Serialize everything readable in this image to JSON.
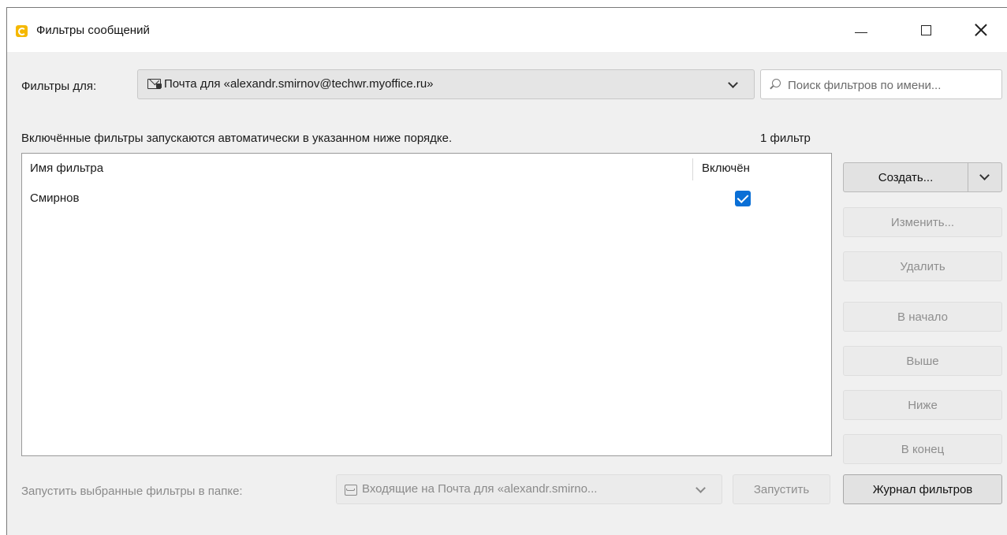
{
  "window": {
    "title": "Фильтры сообщений",
    "minimize_icon": "minimize-icon",
    "maximize_icon": "maximize-icon",
    "close_icon": "close-icon"
  },
  "filters_for": {
    "label": "Фильтры для:",
    "account_value": "Почта для «alexandr.smirnov@techwr.myoffice.ru»"
  },
  "search": {
    "placeholder": "Поиск фильтров по имени..."
  },
  "info": {
    "text": "Включённые фильтры запускаются автоматически в указанном ниже порядке.",
    "count": "1 фильтр"
  },
  "table": {
    "columns": [
      "Имя фильтра",
      "Включён"
    ],
    "rows": [
      {
        "name": "Смирнов",
        "enabled": true
      }
    ]
  },
  "buttons": {
    "create": "Создать...",
    "edit": "Изменить...",
    "delete": "Удалить",
    "to_top": "В начало",
    "up": "Выше",
    "down": "Ниже",
    "to_bottom": "В конец",
    "run": "Запустить",
    "filter_log": "Журнал фильтров"
  },
  "run_section": {
    "label": "Запустить выбранные фильтры в папке:",
    "folder_value": "Входящие на Почта для «alexandr.smirno..."
  },
  "colors": {
    "accent": "#0a6fd6",
    "app_icon": "#f5b800"
  }
}
